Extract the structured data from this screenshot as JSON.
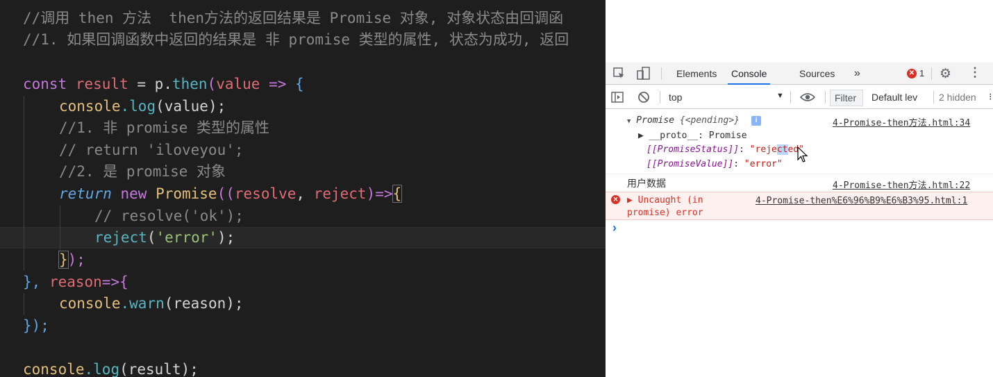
{
  "editor": {
    "lines": {
      "l1_a": "//调用 then 方法  then方法的返回结果是 Promise 对象, 对象状态由回调函",
      "l2_a": "//1. 如果回调函数中返回的结果是 非 promise 类型的属性, 状态为成功, 返回",
      "l4_const": "const ",
      "l4_result": "result",
      "l4_eq": " = ",
      "l4_p": "p",
      "l4_dot": ".",
      "l4_then": "then",
      "l4_paren": "(",
      "l4_value": "value",
      "l4_arrow": " => ",
      "l4_brace": "{",
      "l5_console": "console",
      "l5_log": ".log",
      "l5_rest": "(value);",
      "l6": "//1. 非 promise 类型的属性",
      "l7": "// return 'iloveyou';",
      "l8": "//2. 是 promise 对象",
      "l9_return": "return",
      "l9_new": " new ",
      "l9_promise": "Promise",
      "l9_open": "((",
      "l9_resolve": "resolve",
      "l9_comma": ", ",
      "l9_reject": "reject",
      "l9_close": ")=>",
      "l9_brace": "{",
      "l10": "// resolve('ok');",
      "l11_fn": "reject",
      "l11_open": "(",
      "l11_str": "'error'",
      "l11_close": ");",
      "l12_brace": "}",
      "l12_rest": ");",
      "l13_a": "}, ",
      "l13_reason": "reason",
      "l13_arrow": "=>",
      "l13_brace": "{",
      "l14_console": "console",
      "l14_warn": ".warn",
      "l14_rest": "(reason);",
      "l15": "});",
      "l17_console": "console",
      "l17_log": ".log",
      "l17_rest": "(result);"
    }
  },
  "devtools": {
    "tabs": {
      "elements": "Elements",
      "console": "Console",
      "sources": "Sources",
      "more": "»"
    },
    "error_count": "1",
    "filter_bar": {
      "context": "top",
      "filter_placeholder": "Filter",
      "levels": "Default lev",
      "hidden": "2 hidden"
    },
    "messages": {
      "m1_caret": "▼",
      "m1_promise": "Promise ",
      "m1_pending": "{<pending>}",
      "m1_link": "4-Promise-then方法.html:34",
      "m1_proto": "▶ __proto__: Promise",
      "m1_status_key": "[[PromiseStatus]]",
      "m1_status_sep": ": ",
      "m1_status_val_q1": "\"",
      "m1_status_val_a": "reje",
      "m1_status_val_sel": "ct",
      "m1_status_val_b": "ed",
      "m1_status_val_q2": "\"",
      "m1_value_key": "[[PromiseValue]]",
      "m1_value_sep": ": ",
      "m1_value_val": "\"error\"",
      "m2_text": "用户数据",
      "m2_link": "4-Promise-then方法.html:22",
      "m3_line1": "▶ Uncaught (in",
      "m3_line2": "promise) error",
      "m3_link": "4-Promise-then%E6%96%B9%E6%B3%95.html:1",
      "prompt": "›"
    },
    "colors": {
      "accent": "#1a73e8",
      "error": "#d93025",
      "error_bg": "#fff0f0"
    }
  }
}
